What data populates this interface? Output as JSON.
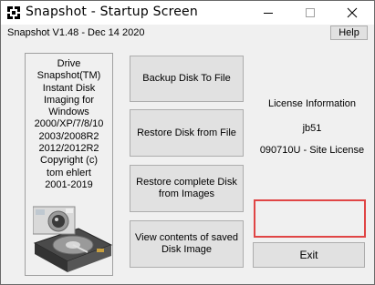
{
  "window": {
    "title": "Snapshot - Startup Screen",
    "icon": "snapshot-app-icon",
    "controls": [
      "minimize-icon",
      "maximize-icon",
      "close-icon"
    ]
  },
  "menubar": {
    "version": "Snapshot V1.48 - Dec 14 2020",
    "help_label": "Help"
  },
  "info_panel": {
    "lines": [
      "Drive",
      "Snapshot(TM)",
      "Instant Disk",
      "Imaging for",
      "Windows",
      "2000/XP/7/8/10",
      "2003/2008R2",
      "2012/2012R2",
      "Copyright (c)",
      "tom ehlert",
      "2001-2019"
    ],
    "image": "hard-disk-and-camera-image"
  },
  "actions": {
    "backup": "Backup Disk To File",
    "restore_file": "Restore Disk from File",
    "restore_images": "Restore complete Disk\nfrom Images",
    "view_contents": "View contents of saved\nDisk Image"
  },
  "license": {
    "heading": "License Information",
    "user": "jb51",
    "key": "090710U - Site License"
  },
  "exit_label": "Exit",
  "colors": {
    "highlight": "#e04545",
    "button_face": "#e1e1e1",
    "window_bg": "#f0f0f0"
  }
}
